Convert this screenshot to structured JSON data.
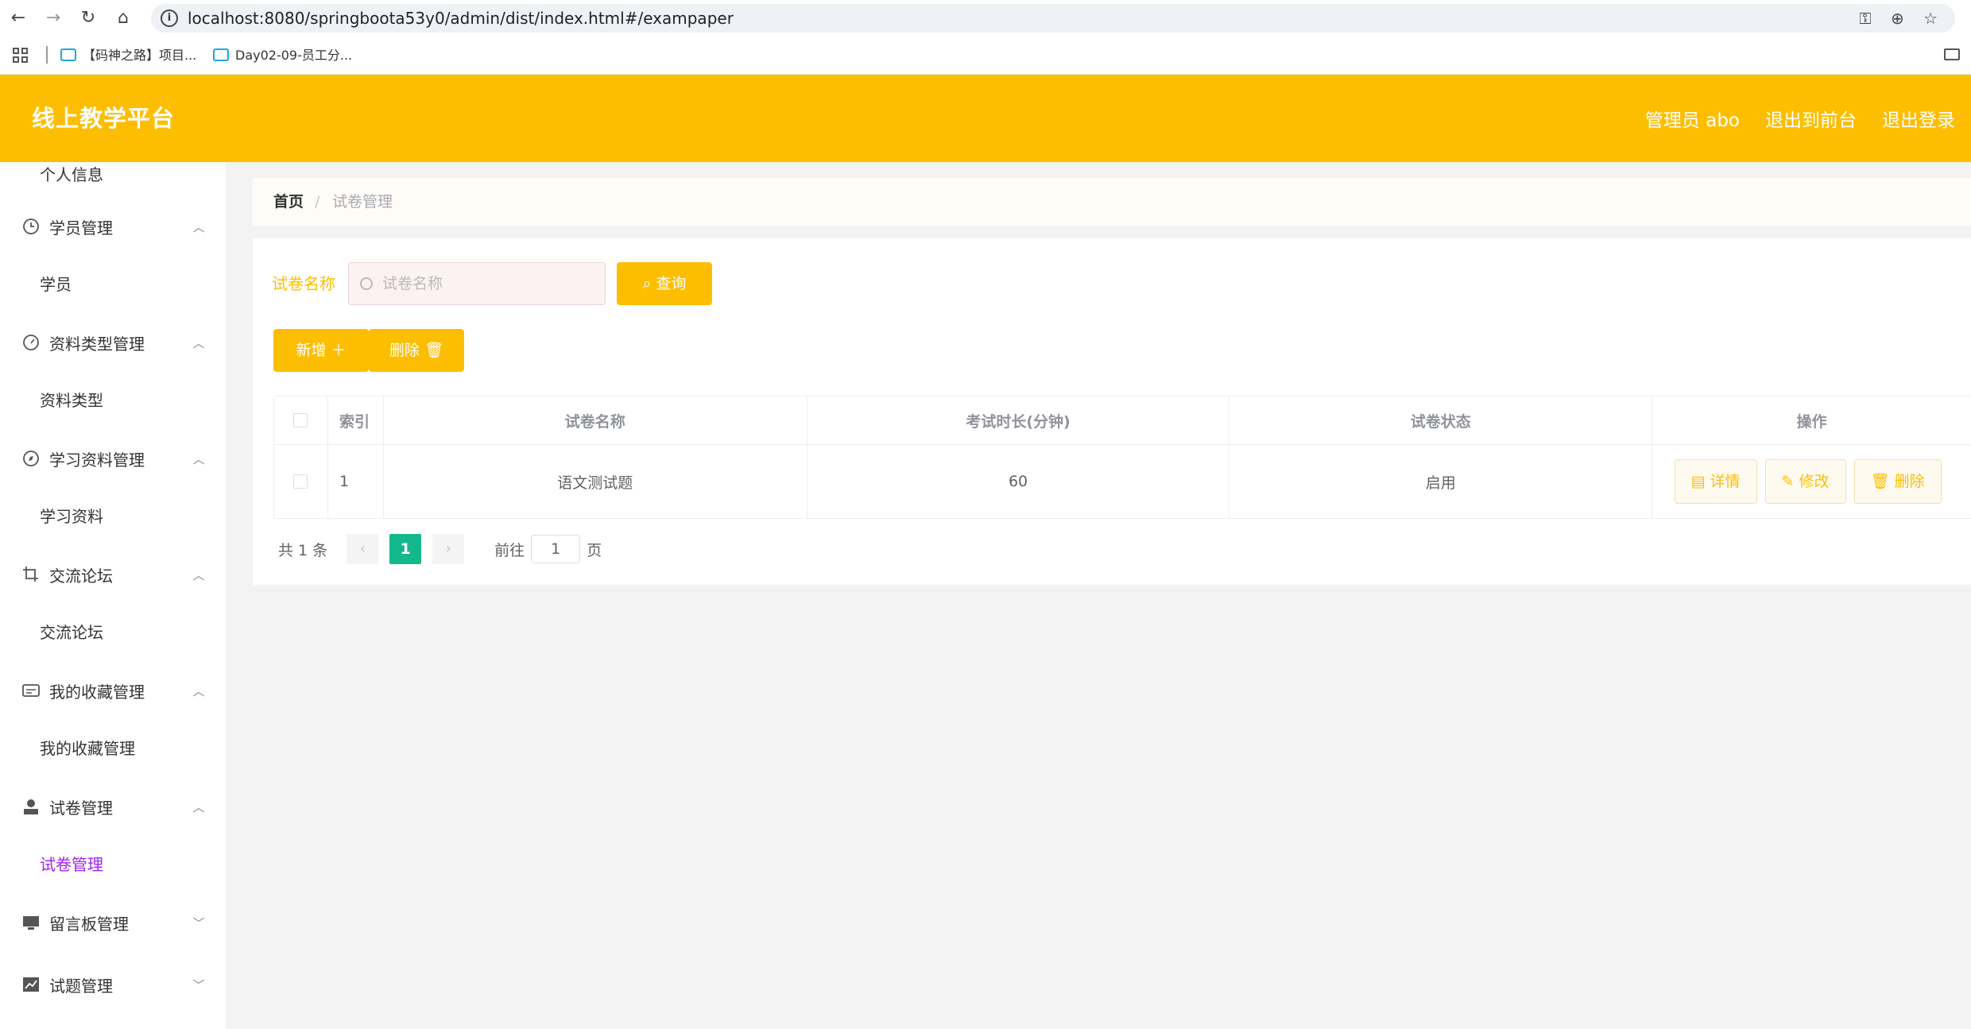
{
  "browser": {
    "url": "localhost:8080/springboota53y0/admin/dist/index.html#/exampaper",
    "bookmarks": [
      "【码神之路】项目...",
      "Day02-09-员工分..."
    ]
  },
  "header": {
    "title": "线上教学平台",
    "user": "管理员 abo",
    "exit_front": "退出到前台",
    "logout": "退出登录"
  },
  "sidebar": {
    "partial_item": "个人信息",
    "groups": [
      {
        "label": "学员管理",
        "icon": "clock-icon",
        "child": "学员",
        "expanded": true
      },
      {
        "label": "资料类型管理",
        "icon": "dashboard-icon",
        "child": "资料类型",
        "expanded": true
      },
      {
        "label": "学习资料管理",
        "icon": "compass-icon",
        "child": "学习资料",
        "expanded": true
      },
      {
        "label": "交流论坛",
        "icon": "crop-icon",
        "child": "交流论坛",
        "expanded": true
      },
      {
        "label": "我的收藏管理",
        "icon": "card-icon",
        "child": "我的收藏管理",
        "expanded": true
      },
      {
        "label": "试卷管理",
        "icon": "user-icon",
        "child": "试卷管理",
        "expanded": true
      },
      {
        "label": "留言板管理",
        "icon": "monitor-icon",
        "child": "",
        "expanded": false
      },
      {
        "label": "试题管理",
        "icon": "chart-icon",
        "child": "",
        "expanded": false
      }
    ]
  },
  "breadcrumb": {
    "home": "首页",
    "separator": "/",
    "current": "试卷管理"
  },
  "search": {
    "label": "试卷名称",
    "placeholder": "试卷名称",
    "query_button": "查询"
  },
  "actions": {
    "add": "新增",
    "delete": "删除"
  },
  "table": {
    "headers": [
      "索引",
      "试卷名称",
      "考试时长(分钟)",
      "试卷状态",
      "操作"
    ],
    "rows": [
      {
        "index": "1",
        "name": "语文测试题",
        "duration": "60",
        "status": "启用"
      }
    ],
    "row_actions": {
      "detail": "详情",
      "edit": "修改",
      "delete": "删除"
    }
  },
  "pagination": {
    "total": "共 1 条",
    "current_page": "1",
    "goto_label": "前往",
    "goto_value": "1",
    "page_suffix": "页"
  },
  "colors": {
    "accent": "#fdbe02",
    "active_menu": "#a020f0",
    "page_active": "#13b98d"
  }
}
